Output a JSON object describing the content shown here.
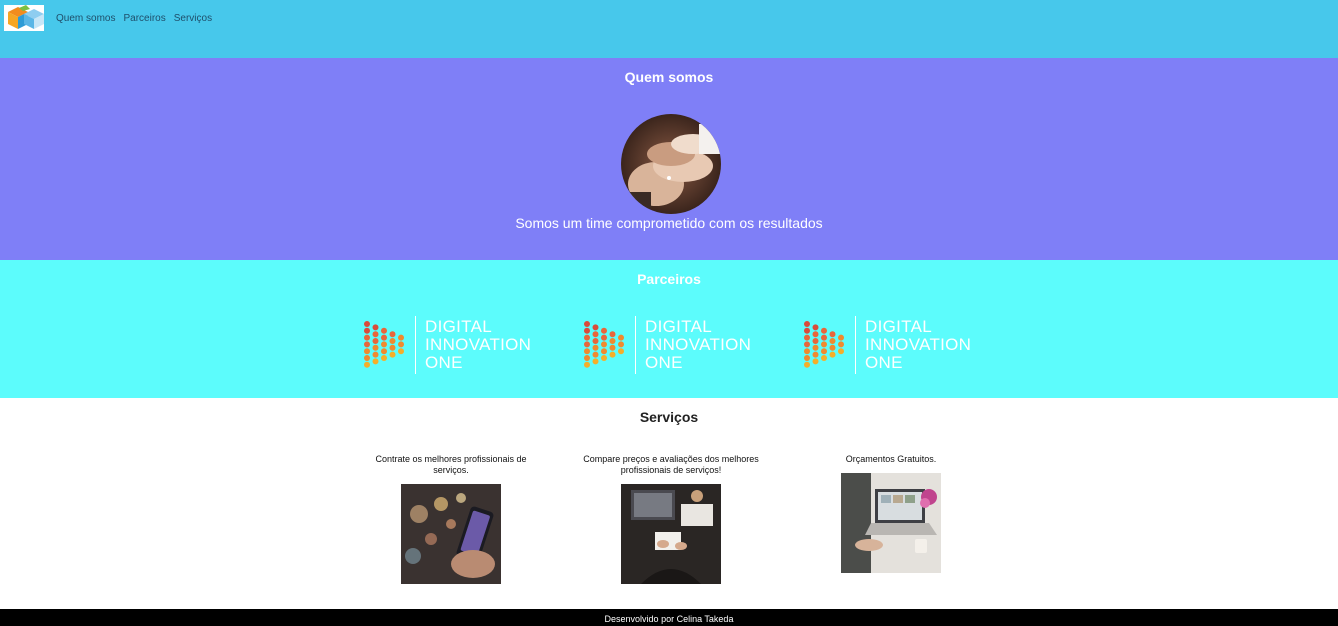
{
  "nav": {
    "items": [
      "Quem somos",
      "Parceiros",
      "Serviços"
    ]
  },
  "about": {
    "title": "Quem somos",
    "tagline": "Somos um time comprometido com os resultados"
  },
  "partners": {
    "title": "Parceiros",
    "logos": [
      {
        "line1": "DIGITAL",
        "line2": "INNOVATION",
        "line3": "ONE"
      },
      {
        "line1": "DIGITAL",
        "line2": "INNOVATION",
        "line3": "ONE"
      },
      {
        "line1": "DIGITAL",
        "line2": "INNOVATION",
        "line3": "ONE"
      }
    ]
  },
  "services": {
    "title": "Serviços",
    "items": [
      {
        "caption": "Contrate os melhores profissionais de serviços."
      },
      {
        "caption": "Compare preços e avaliações dos melhores profissionais de serviços!"
      },
      {
        "caption": "Orçamentos Gratuitos."
      }
    ]
  },
  "footer": {
    "text": "Desenvolvido por Celina Takeda"
  },
  "colors": {
    "header": "#47c8eb",
    "about_bg": "#7f7ff7",
    "partners_bg": "#5cfcfc",
    "footer_bg": "#000000"
  }
}
